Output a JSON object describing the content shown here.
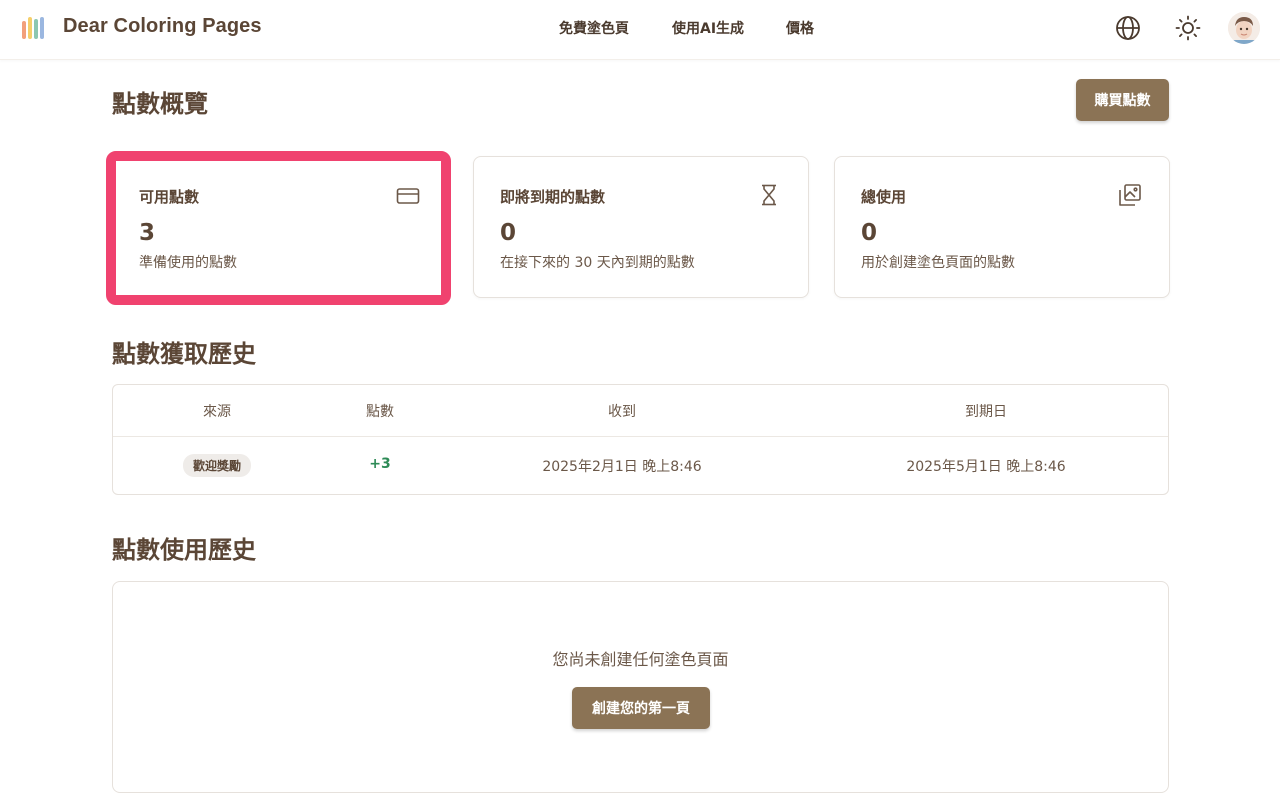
{
  "header": {
    "brand": "Dear Coloring Pages",
    "logo_colors": [
      "#f2a07b",
      "#f5cf6a",
      "#8cc7b0",
      "#9bb7e0"
    ],
    "nav": [
      "免費塗色頁",
      "使用AI生成",
      "價格"
    ]
  },
  "overview": {
    "title": "點數概覽",
    "buy_button": "購買點數"
  },
  "cards": [
    {
      "title": "可用點數",
      "value": "3",
      "subtitle": "準備使用的點數",
      "icon": "credit-card-icon",
      "highlighted": true
    },
    {
      "title": "即將到期的點數",
      "value": "0",
      "subtitle": "在接下來的 30 天內到期的點數",
      "icon": "hourglass-icon",
      "highlighted": false
    },
    {
      "title": "總使用",
      "value": "0",
      "subtitle": "用於創建塗色頁面的點數",
      "icon": "images-icon",
      "highlighted": false
    }
  ],
  "acquisition": {
    "title": "點數獲取歷史",
    "columns": [
      "來源",
      "點數",
      "收到",
      "到期日"
    ],
    "rows": [
      {
        "source": "歡迎獎勵",
        "points": "+3",
        "received": "2025年2月1日 晚上8:46",
        "expires": "2025年5月1日 晚上8:46"
      }
    ]
  },
  "usage": {
    "title": "點數使用歷史",
    "empty_text": "您尚未創建任何塗色頁面",
    "create_button": "創建您的第一頁"
  },
  "colors": {
    "accent": "#8b7355",
    "highlight": "#f0426f",
    "positive": "#2e8b57",
    "text": "#5b4636"
  }
}
